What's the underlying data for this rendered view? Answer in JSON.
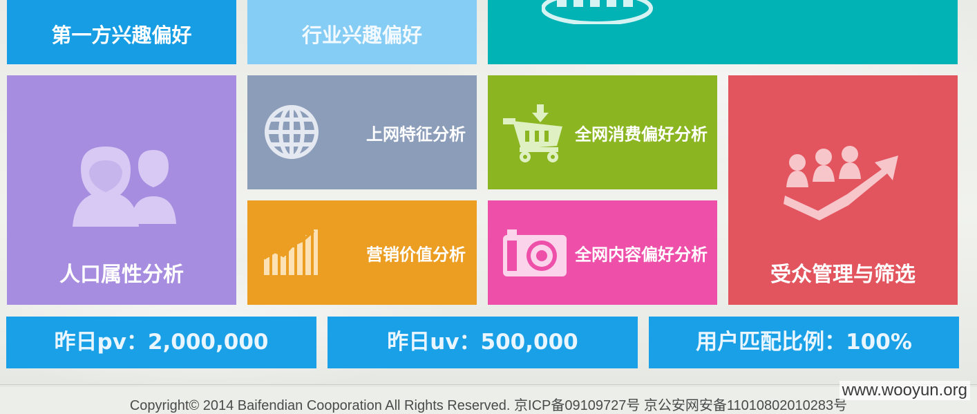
{
  "tiles": {
    "first_party": "第一方兴趣偏好",
    "industry": "行业兴趣偏好",
    "demographics": "人口属性分析",
    "online_features": "上网特征分析",
    "consumption": "全网消费偏好分析",
    "marketing_value": "营销价值分析",
    "content_preference": "全网内容偏好分析",
    "audience": "受众管理与筛选"
  },
  "stats": {
    "pv": "昨日pv：2,000,000",
    "uv": "昨日uv：500,000",
    "match": "用户匹配比例：100%"
  },
  "footer": {
    "copyright": "Copyright© 2014 Baifendian Cooporation All Rights Reserved. 京ICP备09109727号 京公安网安备11010802010283号",
    "watermark": "www.wooyun.org"
  },
  "colors": {
    "blue": "#179de3",
    "light_blue": "#86cdf6",
    "teal": "#02b3b5",
    "purple": "#a78ddf",
    "slate": "#8c9dba",
    "orange": "#eb9e22",
    "green": "#8bb621",
    "pink": "#ee4fa9",
    "red": "#e2545e",
    "stat_blue": "#1aa0e6"
  },
  "icons": {
    "demographics": "people-icon",
    "online_features": "globe-icon",
    "consumption": "cart-icon",
    "marketing_value": "bar-chart-icon",
    "content_preference": "camera-icon",
    "audience": "growth-people-icon",
    "teal": "dashboard-icon"
  }
}
